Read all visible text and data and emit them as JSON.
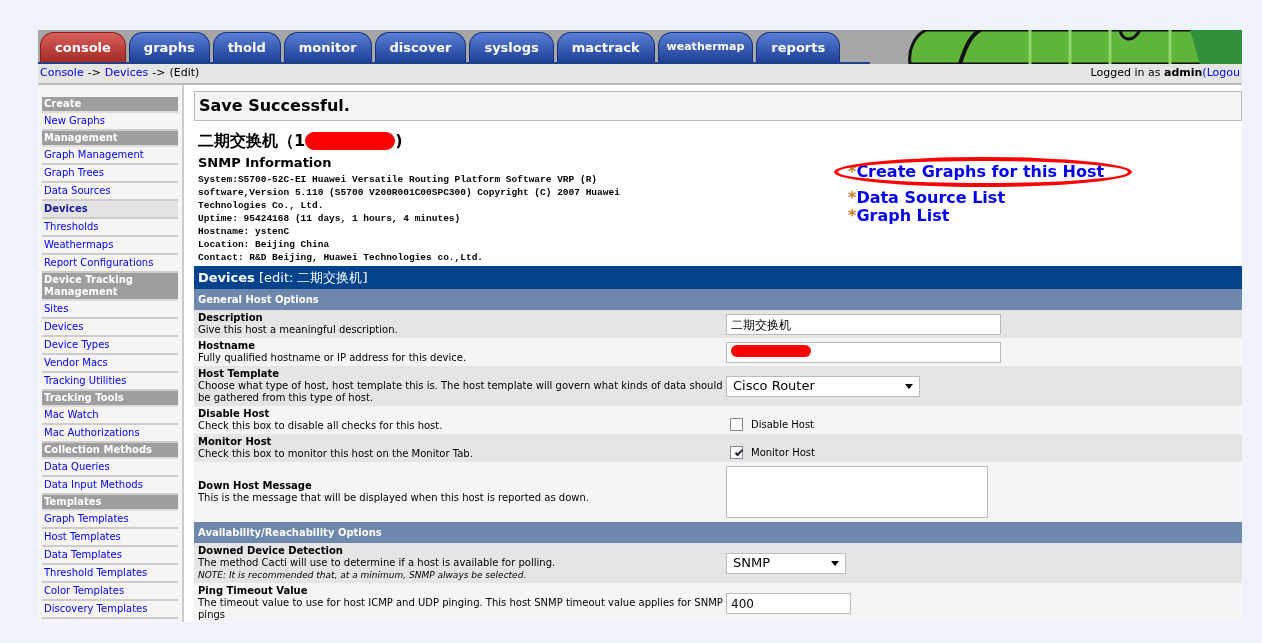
{
  "tabs": [
    {
      "label": "console",
      "selected": true
    },
    {
      "label": "graphs",
      "selected": false
    },
    {
      "label": "thold",
      "selected": false
    },
    {
      "label": "monitor",
      "selected": false
    },
    {
      "label": "discover",
      "selected": false
    },
    {
      "label": "syslogs",
      "selected": false
    },
    {
      "label": "mactrack",
      "selected": false
    },
    {
      "label": "weathermap",
      "selected": false
    },
    {
      "label": "reports",
      "selected": false
    }
  ],
  "breadcrumb": {
    "separator": "->",
    "items": [
      {
        "label": "Console",
        "link": true
      },
      {
        "label": "Devices",
        "link": true
      },
      {
        "label": "(Edit)",
        "link": false
      }
    ]
  },
  "login": {
    "prefix": "Logged in as",
    "user": "admin",
    "logout": "(Logou"
  },
  "sidebar": [
    {
      "kind": "header",
      "label": "Create"
    },
    {
      "kind": "item",
      "label": "New Graphs",
      "selected": false
    },
    {
      "kind": "header",
      "label": "Management"
    },
    {
      "kind": "item",
      "label": "Graph Management",
      "selected": false
    },
    {
      "kind": "item",
      "label": "Graph Trees",
      "selected": false
    },
    {
      "kind": "item",
      "label": "Data Sources",
      "selected": false
    },
    {
      "kind": "item",
      "label": "Devices",
      "selected": true
    },
    {
      "kind": "item",
      "label": "Thresholds",
      "selected": false
    },
    {
      "kind": "item",
      "label": "Weathermaps",
      "selected": false
    },
    {
      "kind": "item",
      "label": "Report Configurations",
      "selected": false
    },
    {
      "kind": "header",
      "label": "Device Tracking Management"
    },
    {
      "kind": "item",
      "label": "Sites",
      "selected": false
    },
    {
      "kind": "item",
      "label": "Devices",
      "selected": false
    },
    {
      "kind": "item",
      "label": "Device Types",
      "selected": false
    },
    {
      "kind": "item",
      "label": "Vendor Macs",
      "selected": false
    },
    {
      "kind": "item",
      "label": "Tracking Utilities",
      "selected": false
    },
    {
      "kind": "header",
      "label": "Tracking Tools"
    },
    {
      "kind": "item",
      "label": "Mac Watch",
      "selected": false
    },
    {
      "kind": "item",
      "label": "Mac Authorizations",
      "selected": false
    },
    {
      "kind": "header",
      "label": "Collection Methods"
    },
    {
      "kind": "item",
      "label": "Data Queries",
      "selected": false
    },
    {
      "kind": "item",
      "label": "Data Input Methods",
      "selected": false
    },
    {
      "kind": "header",
      "label": "Templates"
    },
    {
      "kind": "item",
      "label": "Graph Templates",
      "selected": false
    },
    {
      "kind": "item",
      "label": "Host Templates",
      "selected": false
    },
    {
      "kind": "item",
      "label": "Data Templates",
      "selected": false
    },
    {
      "kind": "item",
      "label": "Threshold Templates",
      "selected": false
    },
    {
      "kind": "item",
      "label": "Color Templates",
      "selected": false
    },
    {
      "kind": "item",
      "label": "Discovery Templates",
      "selected": false
    }
  ],
  "message": "Save Successful.",
  "host": {
    "title_start": "二期交换机（1",
    "title_end": ")",
    "redacted": true
  },
  "snmp": {
    "heading": "SNMP Information",
    "lines": [
      "System:S5700-52C-EI Huawei Versatile Routing Platform Software VRP (R) software,Version 5.110 (S5700 V200R001C00SPC300) Copyright (C) 2007 Huawei Technologies Co., Ltd.",
      "Uptime: 95424168 (11 days, 1 hours, 4 minutes)",
      "Hostname: ystenC",
      "Location: Beijing China",
      "Contact: R&D Beijing, Huawei Technologies co.,Ltd."
    ]
  },
  "host_links": [
    {
      "bullet": "*",
      "label": "Create Graphs for this Host",
      "circled": true
    },
    {
      "bullet": "*",
      "label": "Data Source List",
      "circled": false
    },
    {
      "bullet": "*",
      "label": "Graph List",
      "circled": false
    }
  ],
  "form": {
    "title": "Devices",
    "subtitle": "[edit: 二期交换机]",
    "sections": [
      {
        "title": "General Host Options",
        "rows": [
          {
            "kind": "text",
            "label": "Description",
            "description": "Give this host a meaningful description.",
            "value": "二期交换机"
          },
          {
            "kind": "text",
            "label": "Hostname",
            "description": "Fully qualified hostname or IP address for this device.",
            "value": "",
            "redacted": true
          },
          {
            "kind": "select",
            "label": "Host Template",
            "description": "Choose what type of host, host template this is. The host template will govern what kinds of data should be gathered from this type of host.",
            "value": "Cisco Router"
          },
          {
            "kind": "checkbox",
            "label": "Disable Host",
            "description": "Check this box to disable all checks for this host.",
            "option": "Disable Host",
            "checked": false
          },
          {
            "kind": "checkbox",
            "label": "Monitor Host",
            "description": "Check this box to monitor this host on the Monitor Tab.",
            "option": "Monitor Host",
            "checked": true
          },
          {
            "kind": "textarea",
            "label": "Down Host Message",
            "description": "This is the message that will be displayed when this host is reported as down."
          }
        ]
      },
      {
        "title": "Availability/Reachability Options",
        "rows": [
          {
            "kind": "select",
            "label": "Downed Device Detection",
            "description": "The method Cacti will use to determine if a host is available for polling.",
            "note": "NOTE: It is recommended that, at a minimum, SNMP always be selected.",
            "value": "SNMP"
          },
          {
            "kind": "text",
            "label": "Ping Timeout Value",
            "description": "The timeout value to use for host ICMP and UDP pinging. This host SNMP timeout value applies for SNMP pings",
            "value": "400",
            "short": true
          }
        ]
      }
    ]
  }
}
